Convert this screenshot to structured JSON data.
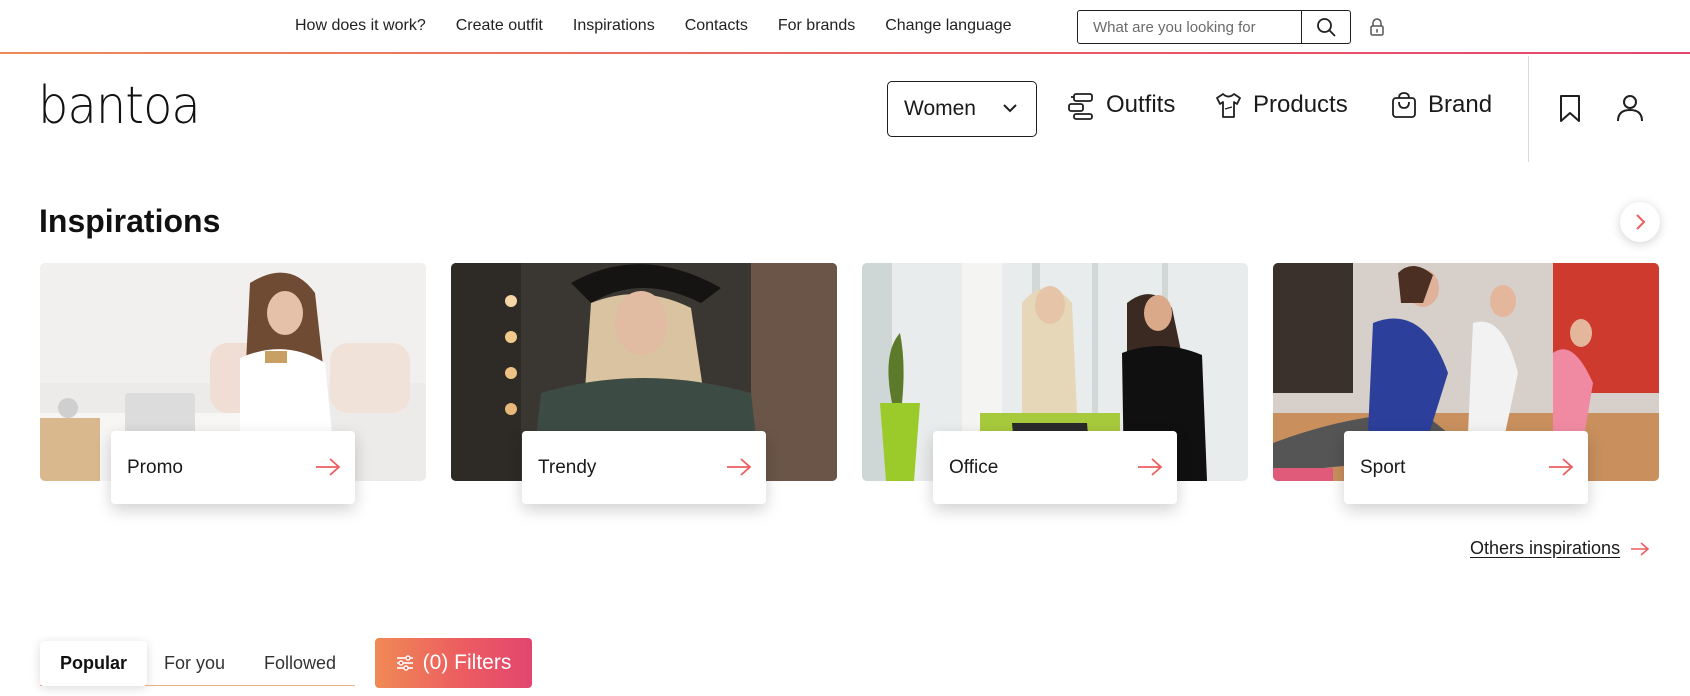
{
  "topnav": {
    "links": [
      "How does it work?",
      "Create outfit",
      "Inspirations",
      "Contacts",
      "For brands",
      "Change language"
    ],
    "search_placeholder": "What are you looking for"
  },
  "header": {
    "logo": "bantoa",
    "gender_select": "Women",
    "nav": {
      "outfits": "Outfits",
      "products": "Products",
      "brand": "Brand"
    }
  },
  "inspirations": {
    "title": "Inspirations",
    "cards": [
      {
        "label": "Promo"
      },
      {
        "label": "Trendy"
      },
      {
        "label": "Office"
      },
      {
        "label": "Sport"
      }
    ],
    "others_link": "Others inspirations"
  },
  "feed": {
    "tabs": [
      "Popular",
      "For you",
      "Followed"
    ],
    "active_tab": "Popular",
    "filters_label": "(0) Filters"
  },
  "colors": {
    "accent_orange": "#f08a55",
    "accent_pink": "#e2456f",
    "arrow": "#ec5d60"
  }
}
